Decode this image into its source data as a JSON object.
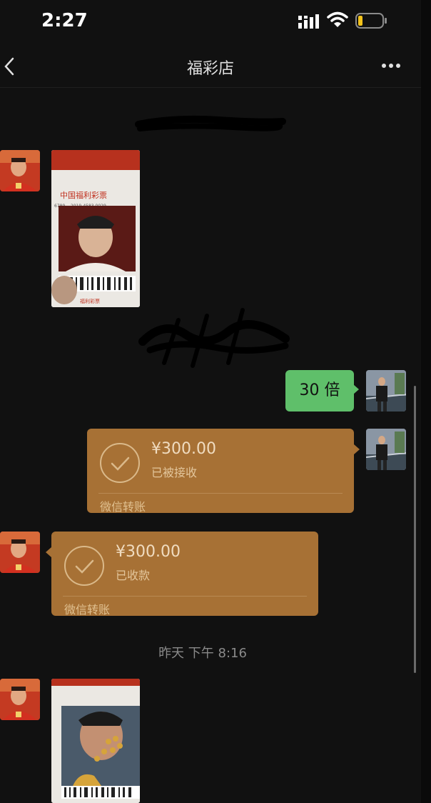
{
  "status_bar": {
    "time": "2:27"
  },
  "header": {
    "title": "福彩店"
  },
  "messages": {
    "text_bubble": {
      "text": "30 倍"
    },
    "transfer_sent": {
      "amount": "¥300.00",
      "status": "已被接收",
      "brand": "微信转账"
    },
    "transfer_received": {
      "amount": "¥300.00",
      "status": "已收款",
      "brand": "微信转账"
    },
    "timestamp": "昨天 下午 8:16"
  },
  "ticket": {
    "logo_text": "中国福利彩票",
    "number_text": "6789... 2019-4583 0029",
    "footer_text": "福利彩票"
  },
  "icons": {
    "back": "chevron-left-icon",
    "more": "ellipsis-icon",
    "check": "check-icon",
    "signal": "signal-icon",
    "wifi": "wifi-icon",
    "battery": "battery-icon"
  },
  "colors": {
    "background": "#111111",
    "transfer_card": "#a77135",
    "green_bubble": "#5fbf6a",
    "battery_low": "#f2c21b"
  }
}
